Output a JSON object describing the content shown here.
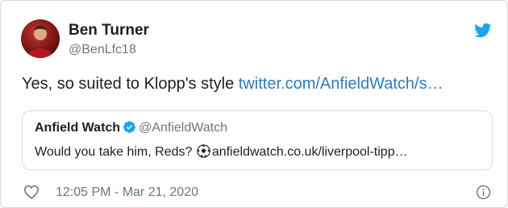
{
  "author": {
    "name": "Ben Turner",
    "handle": "@BenLfc18",
    "avatar_icon": "profile-photo-icon"
  },
  "tweet": {
    "text": "Yes, so suited to Klopp's style ",
    "link": "twitter.com/AnfieldWatch/s…"
  },
  "quoted": {
    "name": "Anfield Watch",
    "handle": "@AnfieldWatch",
    "text_before": "Would you take him, Reds? ",
    "link": "anfieldwatch.co.uk/liverpool-tipp…"
  },
  "footer": {
    "timestamp": "12:05 PM - Mar 21, 2020"
  },
  "colors": {
    "link": "#2b7bb9",
    "twitter_blue": "#1da1f2",
    "secondary_text": "#697882",
    "border": "#d6dbdf"
  },
  "icons": [
    "twitter-bird-icon",
    "verified-badge-icon",
    "soccer-ball-icon",
    "heart-icon",
    "info-icon"
  ]
}
